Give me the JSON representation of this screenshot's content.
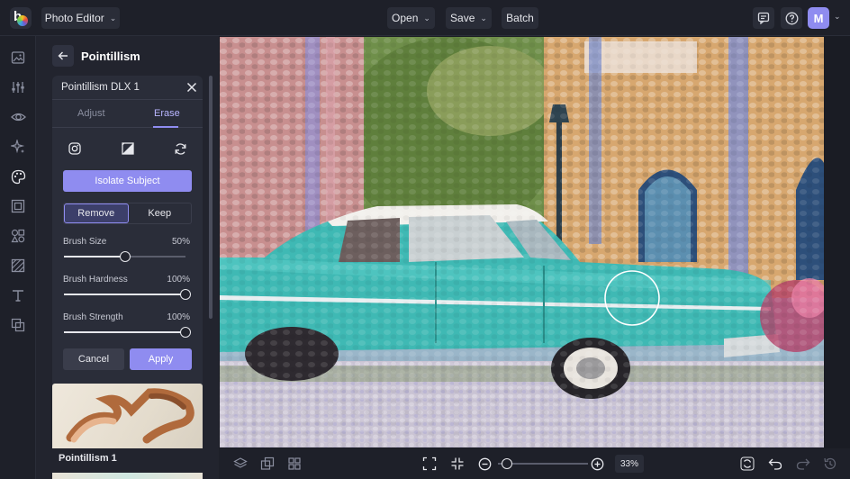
{
  "topbar": {
    "app_menu_label": "Photo Editor",
    "open_label": "Open",
    "save_label": "Save",
    "batch_label": "Batch",
    "avatar_letter": "M",
    "icons": [
      "feedback-icon",
      "help-icon"
    ]
  },
  "leftnav": {
    "items": [
      "image-icon",
      "adjust-sliders-icon",
      "eye-icon",
      "effects-sparkle-icon",
      "artsy-palette-icon",
      "frame-icon",
      "graphics-shapes-icon",
      "texture-icon",
      "text-icon",
      "overlay-icon"
    ],
    "active": "artsy-palette-icon"
  },
  "panel": {
    "title": "Pointillism",
    "card_title": "Pointillism DLX 1",
    "tabs": [
      {
        "label": "Adjust",
        "active": false
      },
      {
        "label": "Erase",
        "active": true
      }
    ],
    "isolate_label": "Isolate Subject",
    "mode": {
      "remove_label": "Remove",
      "keep_label": "Keep",
      "selected": "Remove"
    },
    "sliders": [
      {
        "label": "Brush Size",
        "value_text": "50%",
        "fraction": 0.5
      },
      {
        "label": "Brush Hardness",
        "value_text": "100%",
        "fraction": 1.0
      },
      {
        "label": "Brush Strength",
        "value_text": "100%",
        "fraction": 1.0
      }
    ],
    "cancel_label": "Cancel",
    "apply_label": "Apply",
    "thumbnail_label": "Pointillism 1"
  },
  "bottombar": {
    "zoom_text": "33%",
    "zoom_fraction": 0.1
  },
  "colors": {
    "accent": "#8f8cf0",
    "background": "#1a1c24",
    "panel": "#22242e"
  }
}
